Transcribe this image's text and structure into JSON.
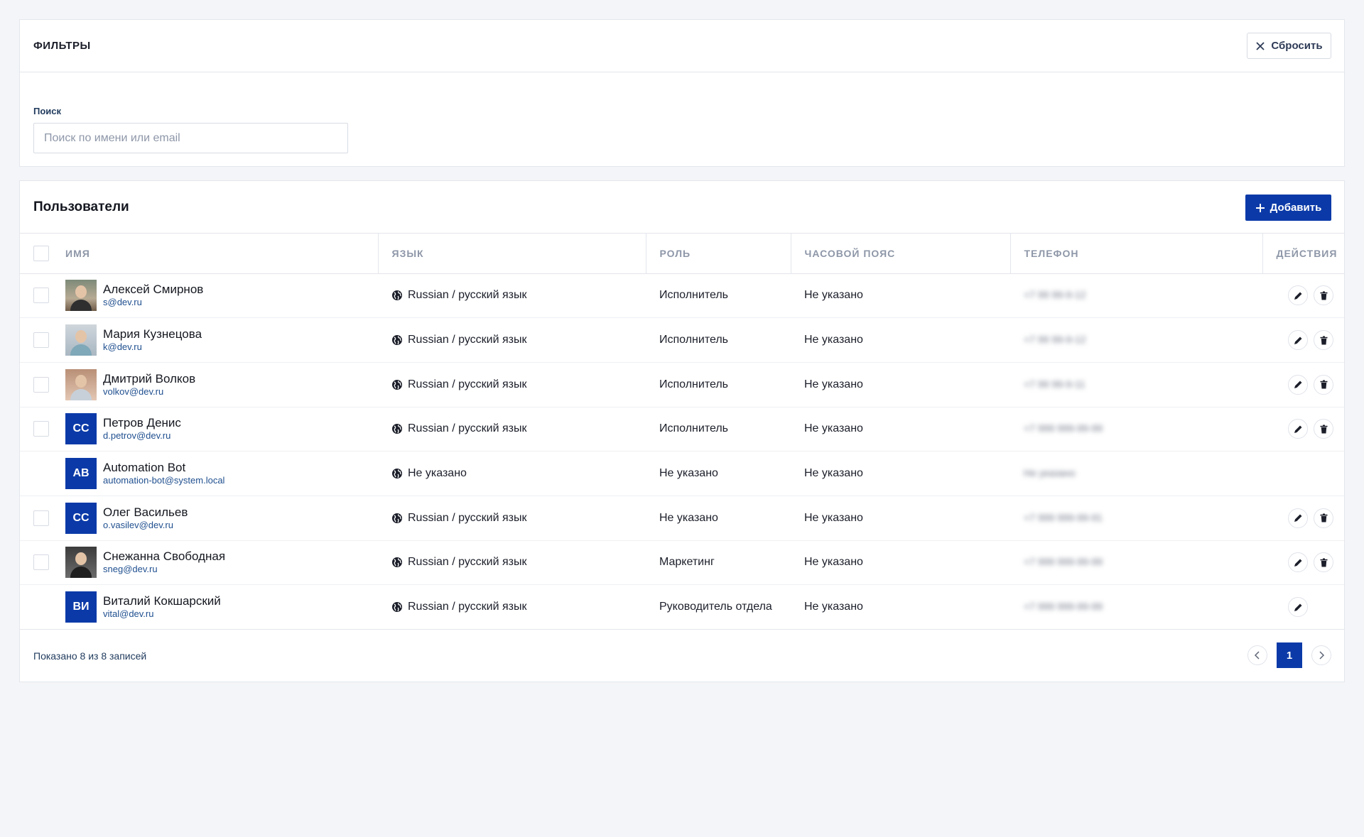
{
  "filters": {
    "title": "ФИЛЬТРЫ",
    "reset_label": "Сбросить",
    "search_label": "Поиск",
    "search_placeholder": "Поиск по имени или email",
    "search_value": ""
  },
  "users": {
    "title": "Пользователи",
    "add_label": "Добавить",
    "columns": {
      "name": "Имя",
      "language": "Язык",
      "role": "Роль",
      "timezone": "Часовой пояс",
      "phone": "Телефон",
      "actions": "Действия"
    },
    "rows": [
      {
        "name": "Алексей Смирнов",
        "email": "s@dev.ru",
        "avatar": "photo",
        "initials": "",
        "language": "Russian / русский язык",
        "role": "Исполнитель",
        "timezone": "Не указано",
        "phone": "+7 99 99-9-12",
        "selectable": true,
        "edit": true,
        "delete": true
      },
      {
        "name": "Мария Кузнецова",
        "email": "k@dev.ru",
        "avatar": "photo",
        "initials": "",
        "language": "Russian / русский язык",
        "role": "Исполнитель",
        "timezone": "Не указано",
        "phone": "+7 99 99-9-12",
        "selectable": true,
        "edit": true,
        "delete": true
      },
      {
        "name": "Дмитрий Волков",
        "email": "volkov@dev.ru",
        "avatar": "photo",
        "initials": "",
        "language": "Russian / русский язык",
        "role": "Исполнитель",
        "timezone": "Не указано",
        "phone": "+7 99 99-9-11",
        "selectable": true,
        "edit": true,
        "delete": true
      },
      {
        "name": "Петров Денис",
        "email": "d.petrov@dev.ru",
        "avatar": "initials",
        "initials": "СС",
        "language": "Russian / русский язык",
        "role": "Исполнитель",
        "timezone": "Не указано",
        "phone": "+7 999 999-99-99",
        "selectable": true,
        "edit": true,
        "delete": true
      },
      {
        "name": "Automation Bot",
        "email": "automation-bot@system.local",
        "avatar": "initials",
        "initials": "AB",
        "language": "Не указано",
        "role": "Не указано",
        "timezone": "Не указано",
        "phone": "Не указано",
        "selectable": false,
        "edit": false,
        "delete": false
      },
      {
        "name": "Олег Васильев",
        "email": "o.vasilev@dev.ru",
        "avatar": "initials",
        "initials": "СС",
        "language": "Russian / русский язык",
        "role": "Не указано",
        "timezone": "Не указано",
        "phone": "+7 999 999-99-91",
        "selectable": true,
        "edit": true,
        "delete": true
      },
      {
        "name": "Снежанна Свободная",
        "email": "sneg@dev.ru",
        "avatar": "photo",
        "initials": "",
        "language": "Russian / русский язык",
        "role": "Маркетинг",
        "timezone": "Не указано",
        "phone": "+7 999 999-99-99",
        "selectable": true,
        "edit": true,
        "delete": true
      },
      {
        "name": "Виталий Кокшарский",
        "email": "vital@dev.ru",
        "avatar": "initials",
        "initials": "ВИ",
        "language": "Russian / русский язык",
        "role": "Руководитель отдела",
        "timezone": "Не указано",
        "phone": "+7 999 999-99-99",
        "selectable": false,
        "edit": true,
        "delete": false
      }
    ],
    "footer": {
      "shown_text": "Показано 8 из 8 записей",
      "current_page": "1"
    }
  },
  "colors": {
    "accent": "#0b3aa8",
    "background": "#f4f5f8",
    "border": "#e3e6ec"
  }
}
